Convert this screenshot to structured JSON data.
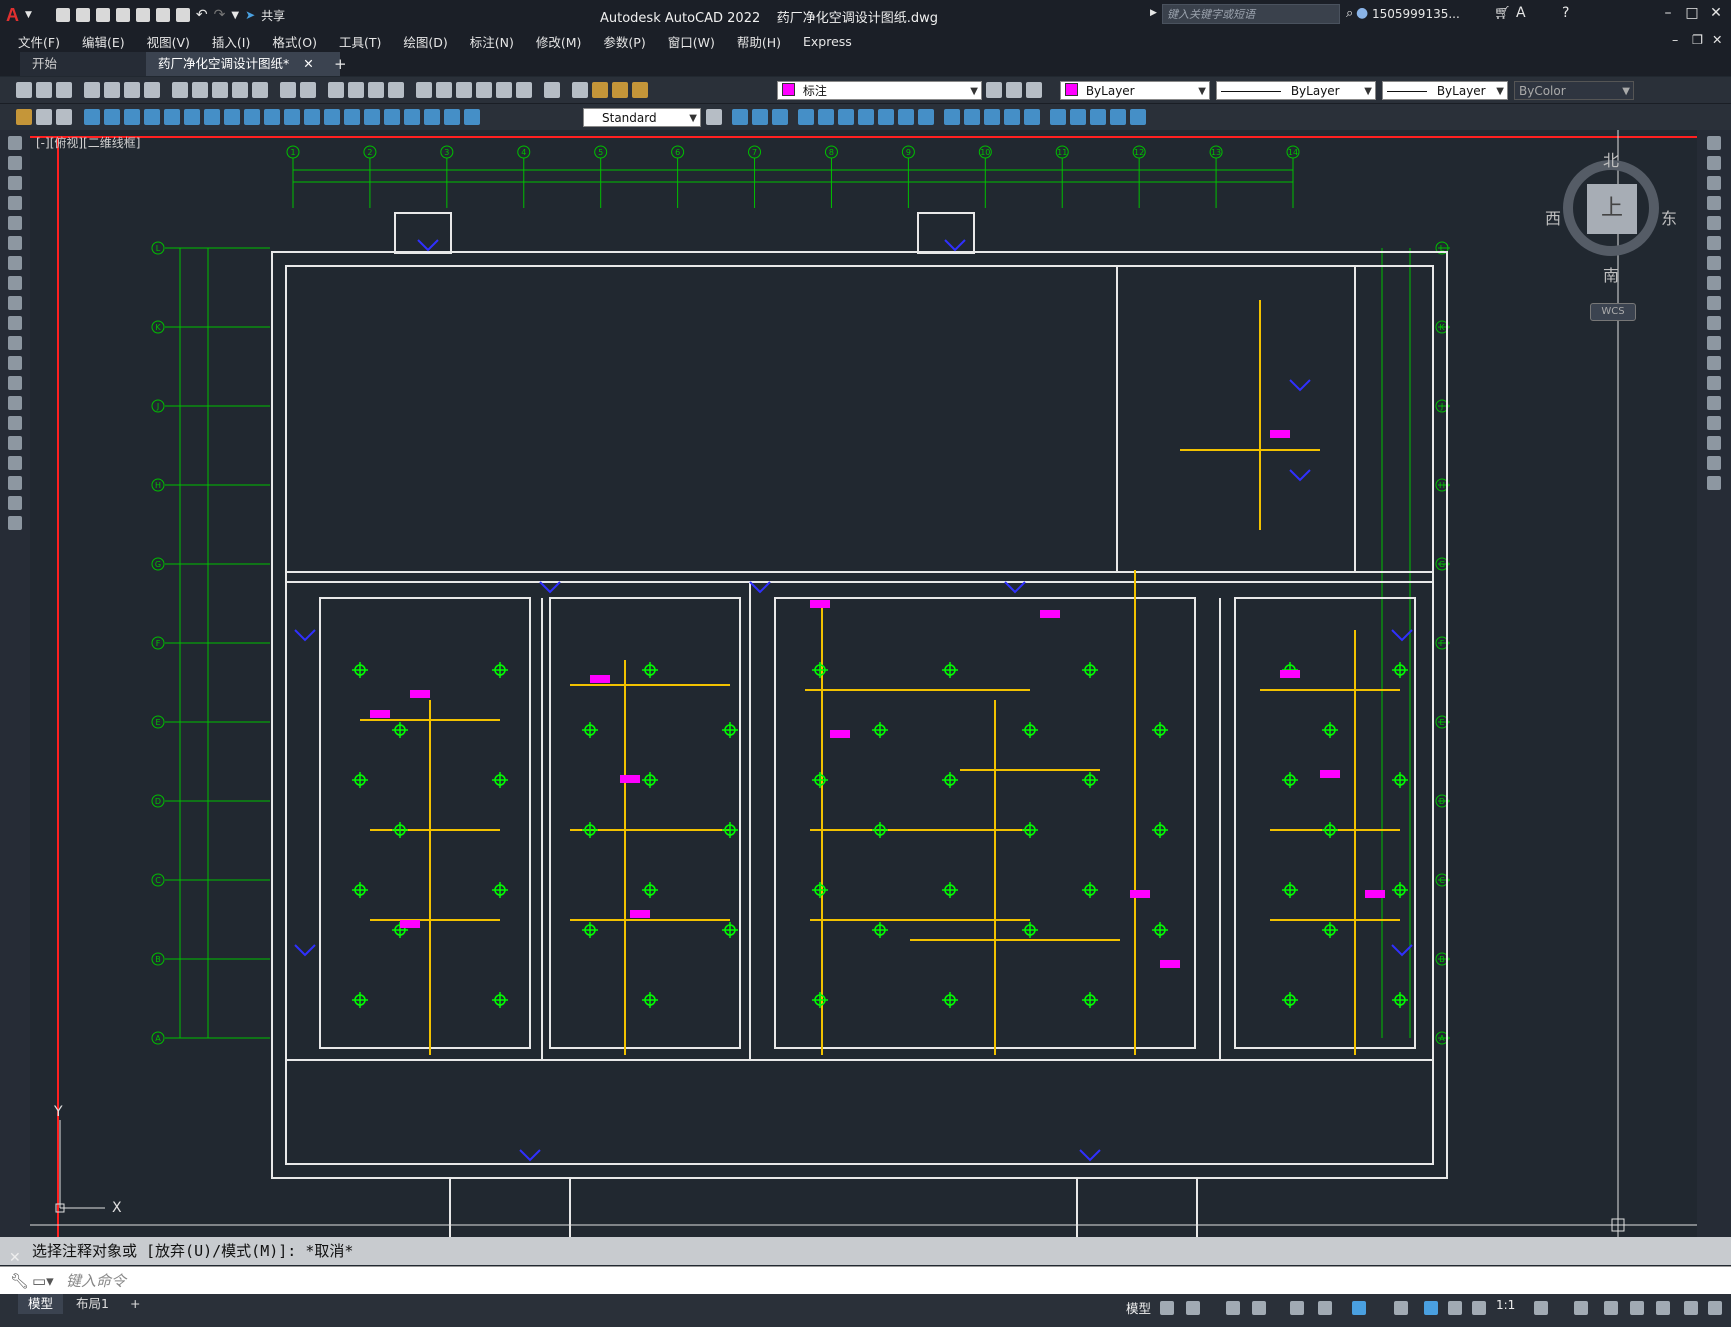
{
  "app": {
    "title": "Autodesk AutoCAD 2022",
    "document": "药厂净化空调设计图纸.dwg",
    "share_label": "共享",
    "search_placeholder": "键入关键字或短语",
    "user": "1505999135..."
  },
  "menu": [
    "文件(F)",
    "编辑(E)",
    "视图(V)",
    "插入(I)",
    "格式(O)",
    "工具(T)",
    "绘图(D)",
    "标注(N)",
    "修改(M)",
    "参数(P)",
    "窗口(W)",
    "帮助(H)",
    "Express"
  ],
  "tabs": {
    "start": "开始",
    "doc": "药厂净化空调设计图纸*",
    "add": "+"
  },
  "toolbar": {
    "layer": "标注",
    "color": "ByLayer",
    "linetype": "ByLayer",
    "lineweight": "ByLayer",
    "plotstyle": "ByColor",
    "textstyle": "Standard"
  },
  "viewport": {
    "label": "[-][俯视][二维线框]",
    "viewcube": {
      "top": "上",
      "north": "北",
      "south": "南",
      "east": "东",
      "west": "西",
      "wcs": "WCS"
    }
  },
  "grid": {
    "top_axes": [
      "1",
      "2",
      "3",
      "4",
      "5",
      "6",
      "7",
      "8",
      "9",
      "10",
      "11",
      "12",
      "13",
      "14"
    ],
    "left_axes": [
      "L",
      "K",
      "J",
      "H",
      "G",
      "F",
      "E",
      "D",
      "C",
      "B",
      "A"
    ]
  },
  "command": {
    "history": "选择注释对象或 [放弃(U)/模式(M)]: *取消*",
    "placeholder": "键入命令"
  },
  "status": {
    "model_tab": "模型",
    "layout_tab": "布局1",
    "add_tab": "+",
    "model_label": "模型",
    "scale": "1:1"
  },
  "colors": {
    "wall": "#e8e8e8",
    "duct": "#f2c200",
    "diffuser": "#00ff00",
    "label": "#ff00ff",
    "text": "#00ffff",
    "door": "#3030ff",
    "axis": "#00c000",
    "crosshair": "#e0e0e0",
    "border": "#ff2020"
  }
}
